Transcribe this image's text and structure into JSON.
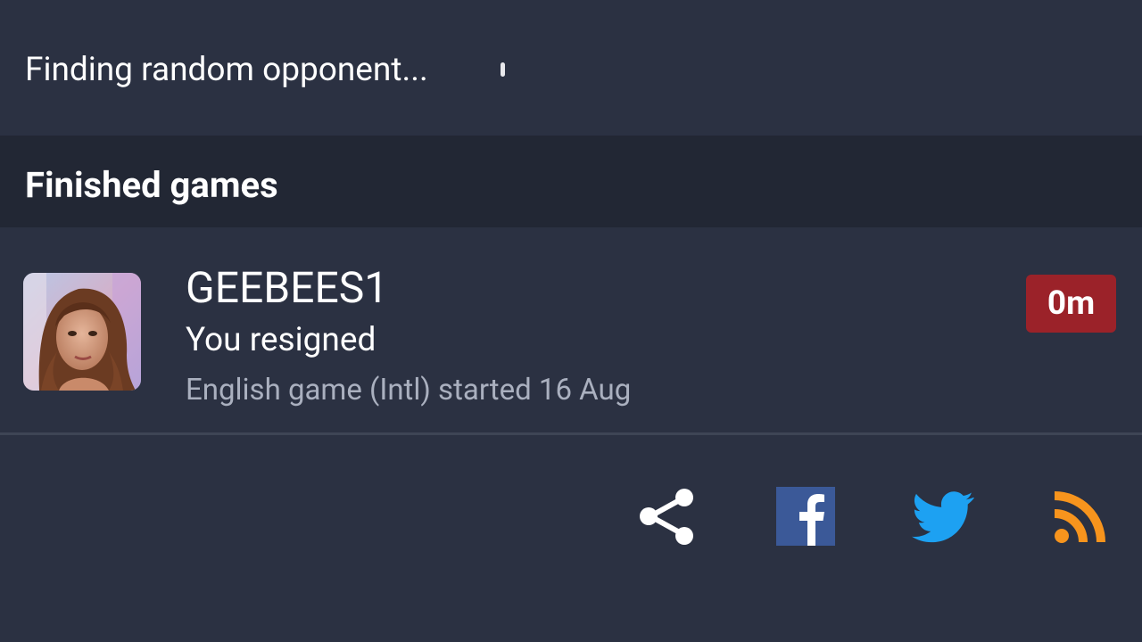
{
  "matchmaking": {
    "status_text": "Finding random opponent..."
  },
  "finished_games": {
    "header": "Finished games",
    "games": [
      {
        "opponent": "GEEBEES1",
        "result": "You resigned",
        "info": "English game (Intl) started 16 Aug",
        "time_badge": "0m"
      }
    ]
  },
  "share_bar": {
    "icons": [
      "share-icon",
      "facebook-icon",
      "twitter-icon",
      "rss-icon"
    ]
  },
  "colors": {
    "background": "#2b3142",
    "section_header": "#222734",
    "badge": "#9b2229",
    "facebook": "#3b5998",
    "twitter": "#1da1f2",
    "rss": "#f7941d"
  }
}
